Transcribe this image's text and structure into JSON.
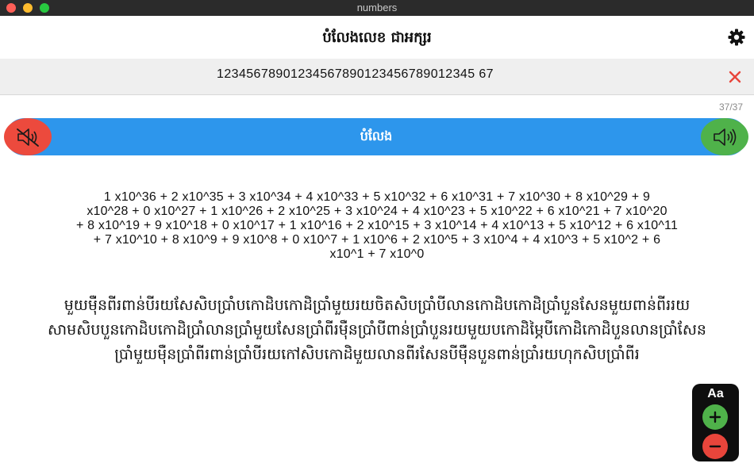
{
  "window": {
    "title": "numbers"
  },
  "header": {
    "title": "បំលែងលេខ ជាអក្សរ",
    "settings_icon": "gear-icon"
  },
  "input": {
    "value": "12345678901234567890123456789012345 67",
    "clear_icon": "close-icon"
  },
  "counter": "37/37",
  "player": {
    "label": "បំលែង",
    "mute_icon": "speaker-mute-icon",
    "speak_icon": "speaker-icon"
  },
  "result": {
    "expression_lines": [
      "1 x10^36 + 2 x10^35 + 3 x10^34 + 4 x10^33 + 5 x10^32 + 6 x10^31 + 7 x10^30 + 8 x10^29 + 9",
      "x10^28 + 0 x10^27 + 1 x10^26 + 2 x10^25 + 3 x10^24 + 4 x10^23 + 5 x10^22 + 6 x10^21 + 7 x10^20",
      "+ 8 x10^19 + 9 x10^18 + 0 x10^17 + 1 x10^16 + 2 x10^15 + 3 x10^14 + 4 x10^13 + 5 x10^12 + 6 x10^11",
      "+ 7 x10^10 + 8 x10^9 + 9 x10^8 + 0 x10^7 + 1 x10^6 + 2 x10^5 + 3 x10^4 + 4 x10^3 + 5 x10^2 + 6",
      "x10^1 + 7 x10^0"
    ],
    "khmer_lines": [
      "មួយម៉ឺនពីរពាន់បីរយសែសិបប្រាំបកោដិបកោដិប្រាំមួយរយចិតសិបប្រាំបីលានកោដិបកោដិប្រាំបួនសែនមួយពាន់ពីររយ",
      "សាមសិបបួនកោដិបកោដិប្រាំលានប្រាំមួយសែនប្រាំពីរម៉ឺនប្រាំបីពាន់ប្រាំបួនរយមួយបកោដិម្ភៃបីកោដិកោដិបួនលានប្រាំសែន",
      "ប្រាំមួយម៉ឺនប្រាំពីរពាន់ប្រាំបីរយកៅសិបកោដិមួយលានពីរសែនបីម៉ឺនបួនពាន់ប្រាំរយហុកសិបប្រាំពីរ"
    ]
  },
  "font_controls": {
    "label": "Aa",
    "increase_icon": "plus-icon",
    "decrease_icon": "minus-icon"
  },
  "colors": {
    "play_bar": "#2d96ec",
    "mute": "#ec4a3d",
    "speak": "#4fb24a",
    "clear": "#e8453b"
  }
}
